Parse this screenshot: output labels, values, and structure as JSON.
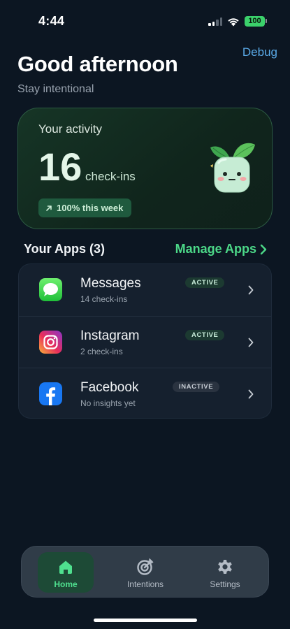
{
  "status_bar": {
    "time": "4:44",
    "battery": "100",
    "icons": [
      "signal-icon",
      "wifi-icon",
      "battery-icon"
    ]
  },
  "header": {
    "debug_label": "Debug",
    "greeting": "Good afternoon",
    "subtitle": "Stay intentional"
  },
  "activity": {
    "title": "Your activity",
    "count": "16",
    "unit": "check-ins",
    "trend_label": "100% this week",
    "trend_icon": "arrow-up-right-icon",
    "mascot_icon": "plant-mascot-icon"
  },
  "apps_section": {
    "title": "Your Apps (3)",
    "manage_label": "Manage Apps",
    "apps": [
      {
        "name": "Messages",
        "subtitle": "14 check-ins",
        "status": "ACTIVE",
        "icon": "messages-app-icon"
      },
      {
        "name": "Instagram",
        "subtitle": "2 check-ins",
        "status": "ACTIVE",
        "icon": "instagram-app-icon"
      },
      {
        "name": "Facebook",
        "subtitle": "No insights yet",
        "status": "INACTIVE",
        "icon": "facebook-app-icon"
      }
    ]
  },
  "tab_bar": {
    "tabs": [
      {
        "label": "Home",
        "icon": "home-icon",
        "selected": true
      },
      {
        "label": "Intentions",
        "icon": "target-icon",
        "selected": false
      },
      {
        "label": "Settings",
        "icon": "gear-icon",
        "selected": false
      }
    ]
  },
  "colors": {
    "background": "#0c1622",
    "accent_green": "#4cd888",
    "link_blue": "#5aa9e6",
    "card_green": "#163526",
    "tab_bar": "#303c48"
  }
}
